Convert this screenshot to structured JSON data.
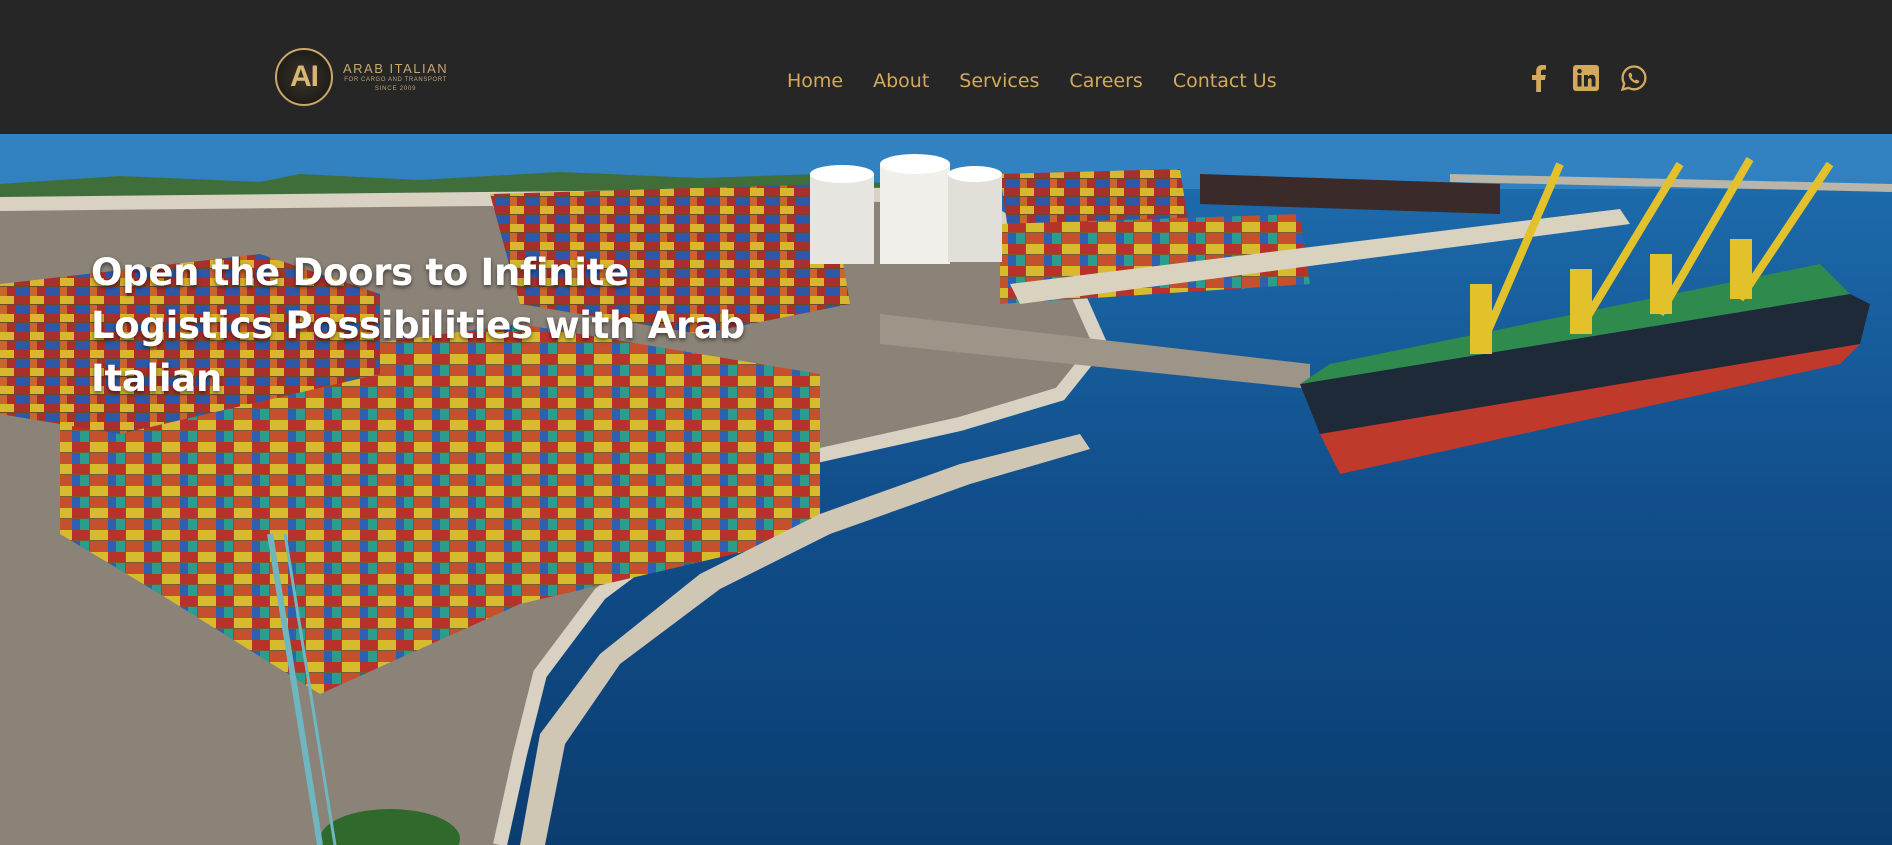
{
  "brand": {
    "mark": "AI",
    "name": "ARAB ITALIAN",
    "tagline": "FOR CARGO AND TRANSPORT",
    "since": "SINCE 2009"
  },
  "nav": {
    "items": [
      {
        "label": "Home"
      },
      {
        "label": "About"
      },
      {
        "label": "Services"
      },
      {
        "label": "Careers"
      },
      {
        "label": "Contact Us"
      }
    ]
  },
  "social": {
    "icons": [
      "facebook-icon",
      "linkedin-icon",
      "whatsapp-icon"
    ]
  },
  "hero": {
    "title": "Open the Doors to Infinite Logistics Possibilities with Arab Italian",
    "image": "aerial view of container port with cargo ship"
  },
  "colors": {
    "header_bg": "#262626",
    "accent_gold": "#d4a95c",
    "hero_text": "#ffffff"
  }
}
